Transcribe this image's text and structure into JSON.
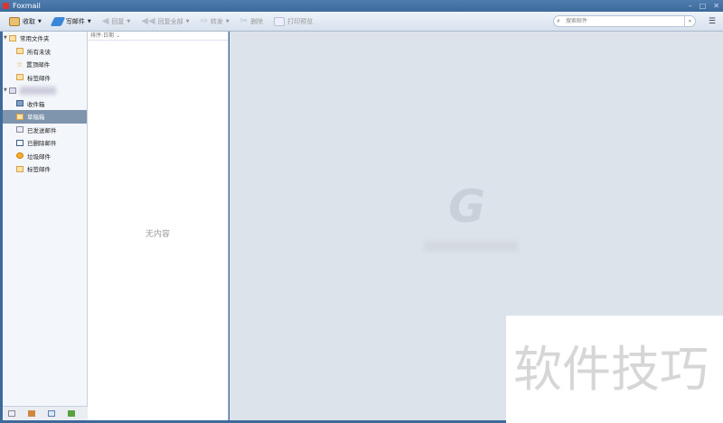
{
  "window": {
    "title": "Foxmail",
    "minimize": "–",
    "maximize": "□",
    "close": "✕"
  },
  "toolbar": {
    "receive": "收取",
    "compose": "写邮件",
    "reply": "回复",
    "reply_all": "回复全部",
    "forward": "转发",
    "delete": "删除",
    "print_preview": "打印预览",
    "search_placeholder": "搜索邮件"
  },
  "sidebar": {
    "common_folder": "常用文件夹",
    "common_items": [
      "所有未读",
      "置顶邮件",
      "标签邮件"
    ],
    "account_items": [
      "收件箱",
      "草稿箱",
      "已发送邮件",
      "已删除邮件",
      "垃圾邮件",
      "标签邮件"
    ]
  },
  "list": {
    "sort_label": "排序:日期",
    "empty_text": "无内容"
  },
  "watermark": "软件技巧"
}
